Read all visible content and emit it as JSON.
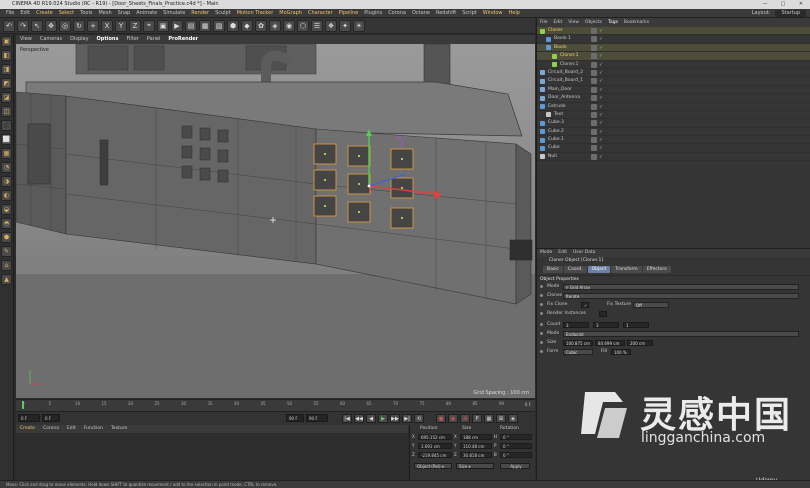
{
  "window": {
    "title": "CINEMA 4D R19.024 Studio (RC - R19) - [Door_Sheets_Finals_Practice.c4d *] - Main",
    "minimize": "—",
    "maximize": "□",
    "close": "✕"
  },
  "menu": {
    "items": [
      "File",
      "Edit",
      "Create",
      "Select",
      "Tools",
      "Mesh",
      "Snap",
      "Animate",
      "Simulate",
      "Render",
      "Sculpt",
      "Motion Tracker",
      "MoGraph",
      "Character",
      "Pipeline",
      "Plugins",
      "Corona",
      "Octane",
      "Redshift",
      "Script",
      "Window",
      "Help"
    ],
    "highlighted": [
      "Create",
      "Select",
      "Render",
      "Motion Tracker",
      "MoGraph",
      "Character",
      "Pipeline",
      "Window",
      "Help"
    ],
    "layout_label": "Layout:",
    "layout_value": "Startup"
  },
  "toolbar": {
    "tools": [
      "↶",
      "↷",
      "↖",
      "✥",
      "◎",
      "↻",
      "+",
      "X",
      "Y",
      "Z",
      "⌖",
      "▣",
      "▶",
      "▤",
      "▦",
      "▧",
      "⬢",
      "◆",
      "✿",
      "◈",
      "◉",
      "⬡",
      "☰",
      "❖",
      "✦",
      "☀"
    ]
  },
  "left_palette": {
    "tools": [
      "▣",
      "◧",
      "◨",
      "◩",
      "◪",
      "◫",
      "⬛",
      "⬜",
      "▦",
      "◔",
      "◑",
      "◐",
      "◒",
      "◓",
      "⬢",
      "✎",
      "⌂",
      "▲"
    ]
  },
  "viewport": {
    "menu": [
      "View",
      "Cameras",
      "Display",
      "Options",
      "Filter",
      "Panel",
      "ProRender"
    ],
    "bold_items": [
      "Options",
      "ProRender"
    ],
    "label": "Perspective",
    "grid_spacing": "Grid Spacing : 100 cm"
  },
  "timeline": {
    "ticks": [
      "0",
      "5",
      "10",
      "15",
      "20",
      "25",
      "30",
      "35",
      "40",
      "45",
      "50",
      "55",
      "60",
      "65",
      "70",
      "75",
      "80",
      "85",
      "90"
    ],
    "end_label": "0 F"
  },
  "playback": {
    "start_field": "0 F",
    "current_field": "0 F",
    "end_field": "90 F",
    "end_field2": "90 F",
    "buttons": [
      "|◀",
      "◀◀",
      "◀",
      "▶",
      "▶▶",
      "▶|",
      "⟲"
    ],
    "rec_buttons": [
      "●",
      "◉",
      "⊕",
      "P",
      "▦",
      "⊞",
      "◈"
    ]
  },
  "material_manager": {
    "menu": [
      "Create",
      "Corona",
      "Edit",
      "Function",
      "Texture"
    ]
  },
  "coordinates": {
    "headers": [
      "Position",
      "Size",
      "Rotation"
    ],
    "rows": [
      {
        "axis": "X",
        "pos": "695.152 cm",
        "size_axis": "X",
        "size": "188 cm",
        "rot_axis": "H",
        "rot": "0 °"
      },
      {
        "axis": "Y",
        "pos": "1.691 cm",
        "size_axis": "Y",
        "size": "110.48 cm",
        "rot_axis": "P",
        "rot": "0 °"
      },
      {
        "axis": "Z",
        "pos": "-219.845 cm",
        "size_axis": "Z",
        "size": "30.818 cm",
        "rot_axis": "B",
        "rot": "0 °"
      }
    ],
    "mode_dropdown": "Object (Rel) ▾",
    "size_dropdown": "Size ▾",
    "apply": "Apply"
  },
  "object_manager": {
    "menu": [
      "File",
      "Edit",
      "View",
      "Objects",
      "Tags",
      "Bookmarks"
    ],
    "objects": [
      {
        "name": "Cloner",
        "indent": 0,
        "color": "#8fd14f",
        "selected": true
      },
      {
        "name": "Boole 1",
        "indent": 1,
        "color": "#5b9bd5",
        "selected": false
      },
      {
        "name": "Boole",
        "indent": 1,
        "color": "#5b9bd5",
        "selected": true
      },
      {
        "name": "Cloner.1",
        "indent": 2,
        "color": "#8fd14f",
        "selected": true
      },
      {
        "name": "Cloner.1",
        "indent": 2,
        "color": "#8fd14f",
        "selected": false
      },
      {
        "name": "Circuit_Board_2",
        "indent": 0,
        "color": "#7fa7d6",
        "selected": false
      },
      {
        "name": "Circuit_Board_1",
        "indent": 0,
        "color": "#7fa7d6",
        "selected": false
      },
      {
        "name": "Main_Door",
        "indent": 0,
        "color": "#7fa7d6",
        "selected": false
      },
      {
        "name": "Door_Antenna",
        "indent": 0,
        "color": "#7fa7d6",
        "selected": false
      },
      {
        "name": "Extrude",
        "indent": 0,
        "color": "#5b9bd5",
        "selected": false
      },
      {
        "name": "Text",
        "indent": 1,
        "color": "#c8c8c8",
        "selected": false
      },
      {
        "name": "Cube.3",
        "indent": 0,
        "color": "#5b9bd5",
        "selected": false
      },
      {
        "name": "Cube.2",
        "indent": 0,
        "color": "#5b9bd5",
        "selected": false
      },
      {
        "name": "Cube.1",
        "indent": 0,
        "color": "#5b9bd5",
        "selected": false
      },
      {
        "name": "Cube",
        "indent": 0,
        "color": "#5b9bd5",
        "selected": false
      },
      {
        "name": "Null",
        "indent": 0,
        "color": "#c8c8c8",
        "selected": false
      }
    ]
  },
  "attributes": {
    "menu": [
      "Mode",
      "Edit",
      "User Data"
    ],
    "title": "Cloner Object [Cloner.1]",
    "tabs": [
      "Basic",
      "Coord.",
      "Object",
      "Transform",
      "Effectors"
    ],
    "active_tab": "Object",
    "section": "Object Properties",
    "rows": {
      "mode_label": "Mode",
      "mode_value": "⁞⁞ Grid Array",
      "clones_label": "Clones",
      "clones_value": "Iterate",
      "fix_clone_label": "Fix Clone",
      "fix_clone_check": "✓",
      "fix_texture_label": "Fix Texture",
      "fix_texture_value": "Off",
      "render_instances_label": "Render Instances",
      "count_label": "Count",
      "count_x": "3",
      "count_y": "3",
      "count_z": "1",
      "mode2_label": "Mode",
      "mode2_value": "Endpoint",
      "size_label": "Size",
      "size_x": "100.875 cm",
      "size_y": "84.699 cm",
      "size_z": "200 cm",
      "form_label": "Form",
      "form_value": "Cubic",
      "fill_label": "Fill",
      "fill_value": "100 %"
    }
  },
  "status_bar": "Move: Click and drag to move elements. Hold down SHIFT to quantize movement / add to the selection in point mode, CTRL to remove.",
  "watermark": {
    "cn": "灵感中国",
    "en": "lingganchina.com",
    "udemy": "Udemy"
  }
}
